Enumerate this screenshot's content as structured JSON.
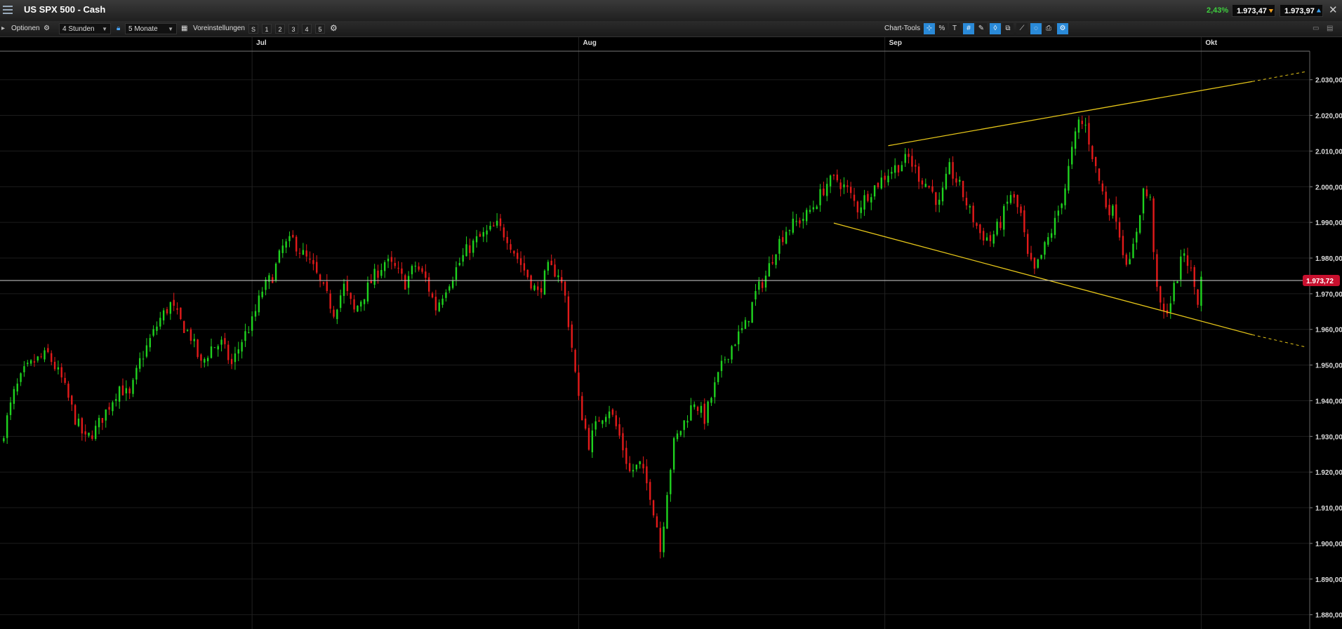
{
  "window": {
    "title": "US SPX 500 - Cash",
    "change_pct": "2,43%",
    "bid": "1.973,47",
    "ask": "1.973,97"
  },
  "toolbar": {
    "options_label": "Optionen",
    "interval_value": "4 Stunden",
    "range_value": "5 Monate",
    "presets_label": "Voreinstellungen",
    "preset_buttons": [
      "S",
      "1",
      "2",
      "3",
      "4",
      "5"
    ],
    "chart_tools_label": "Chart-Tools",
    "tool_icons": [
      "crosshair-tool-icon",
      "percent-icon",
      "text-tool-icon",
      "grid-icon",
      "drawing-tool-icon",
      "indicator-icon",
      "compare-icon",
      "trend-tool-icon",
      "lasso-icon",
      "print-icon",
      "settings-tool-icon"
    ]
  },
  "colors": {
    "up": "#1fd21f",
    "down": "#e21a1a",
    "trendline": "#e6c619",
    "grid": "#1c1c1c",
    "price_badge": "#c8102e",
    "change_positive": "#3ecf3e"
  },
  "chart_data": {
    "type": "candlestick",
    "instrument": "US SPX 500 - Cash",
    "interval": "4 Stunden",
    "range": "5 Monate",
    "current_price": 1973.72,
    "current_price_label": "1.973,72",
    "ylim": [
      1876,
      2038
    ],
    "y_ticks": [
      "2.030,00",
      "2.020,00",
      "2.010,00",
      "2.000,00",
      "1.990,00",
      "1.980,00",
      "1.970,00",
      "1.960,00",
      "1.950,00",
      "1.940,00",
      "1.930,00",
      "1.920,00",
      "1.910,00",
      "1.900,00",
      "1.890,00",
      "1.880,00"
    ],
    "y_tick_values": [
      2030,
      2020,
      2010,
      2000,
      1990,
      1980,
      1970,
      1960,
      1950,
      1940,
      1930,
      1920,
      1910,
      1900,
      1890,
      1880
    ],
    "month_labels": [
      "Jul",
      "Aug",
      "Sep",
      "Okt"
    ],
    "bars_total": 360,
    "month_bar_index": [
      74,
      170,
      260,
      353
    ],
    "anchors": [
      [
        0,
        1928
      ],
      [
        4,
        1942
      ],
      [
        7,
        1948
      ],
      [
        10,
        1951
      ],
      [
        14,
        1953
      ],
      [
        18,
        1946
      ],
      [
        22,
        1935
      ],
      [
        25,
        1929
      ],
      [
        28,
        1932
      ],
      [
        31,
        1937
      ],
      [
        35,
        1944
      ],
      [
        38,
        1941
      ],
      [
        41,
        1951
      ],
      [
        44,
        1957
      ],
      [
        47,
        1963
      ],
      [
        50,
        1967
      ],
      [
        53,
        1962
      ],
      [
        56,
        1958
      ],
      [
        59,
        1950
      ],
      [
        62,
        1955
      ],
      [
        65,
        1956
      ],
      [
        68,
        1950
      ],
      [
        71,
        1957
      ],
      [
        74,
        1962
      ],
      [
        77,
        1971
      ],
      [
        80,
        1975
      ],
      [
        83,
        1983
      ],
      [
        86,
        1985
      ],
      [
        89,
        1981
      ],
      [
        92,
        1977
      ],
      [
        95,
        1971
      ],
      [
        98,
        1965
      ],
      [
        101,
        1972
      ],
      [
        104,
        1965
      ],
      [
        107,
        1970
      ],
      [
        110,
        1975
      ],
      [
        113,
        1979
      ],
      [
        116,
        1977
      ],
      [
        119,
        1973
      ],
      [
        122,
        1978
      ],
      [
        125,
        1974
      ],
      [
        128,
        1966
      ],
      [
        131,
        1972
      ],
      [
        134,
        1977
      ],
      [
        137,
        1982
      ],
      [
        140,
        1985
      ],
      [
        143,
        1987
      ],
      [
        146,
        1989
      ],
      [
        149,
        1986
      ],
      [
        152,
        1980
      ],
      [
        155,
        1975
      ],
      [
        158,
        1970
      ],
      [
        161,
        1977
      ],
      [
        164,
        1976
      ],
      [
        166,
        1969
      ],
      [
        168,
        1955
      ],
      [
        170,
        1940
      ],
      [
        173,
        1928
      ],
      [
        176,
        1935
      ],
      [
        179,
        1938
      ],
      [
        182,
        1930
      ],
      [
        185,
        1920
      ],
      [
        188,
        1922
      ],
      [
        191,
        1914
      ],
      [
        193,
        1905
      ],
      [
        194,
        1898
      ],
      [
        196,
        1915
      ],
      [
        198,
        1928
      ],
      [
        201,
        1934
      ],
      [
        204,
        1940
      ],
      [
        207,
        1935
      ],
      [
        210,
        1944
      ],
      [
        213,
        1952
      ],
      [
        216,
        1957
      ],
      [
        219,
        1961
      ],
      [
        222,
        1970
      ],
      [
        225,
        1975
      ],
      [
        228,
        1983
      ],
      [
        231,
        1988
      ],
      [
        234,
        1990
      ],
      [
        237,
        1992
      ],
      [
        240,
        1996
      ],
      [
        243,
        2001
      ],
      [
        246,
        2002
      ],
      [
        249,
        1999
      ],
      [
        252,
        1994
      ],
      [
        255,
        1998
      ],
      [
        258,
        2001
      ],
      [
        261,
        2004
      ],
      [
        264,
        2006
      ],
      [
        267,
        2008
      ],
      [
        270,
        2003
      ],
      [
        273,
        2000
      ],
      [
        276,
        1995
      ],
      [
        279,
        2005
      ],
      [
        282,
        2000
      ],
      [
        285,
        1993
      ],
      [
        288,
        1987
      ],
      [
        291,
        1985
      ],
      [
        294,
        1990
      ],
      [
        297,
        1998
      ],
      [
        300,
        1992
      ],
      [
        302,
        1980
      ],
      [
        304,
        1976
      ],
      [
        307,
        1983
      ],
      [
        310,
        1990
      ],
      [
        313,
        2000
      ],
      [
        315,
        2010
      ],
      [
        317,
        2018
      ],
      [
        319,
        2017
      ],
      [
        322,
        2005
      ],
      [
        325,
        1995
      ],
      [
        328,
        1992
      ],
      [
        330,
        1982
      ],
      [
        332,
        1978
      ],
      [
        334,
        1988
      ],
      [
        336,
        1999
      ],
      [
        338,
        1996
      ],
      [
        340,
        1970
      ],
      [
        342,
        1964
      ],
      [
        344,
        1968
      ],
      [
        346,
        1975
      ],
      [
        348,
        1982
      ],
      [
        350,
        1976
      ],
      [
        352,
        1968
      ],
      [
        353,
        1974
      ]
    ],
    "trendlines": [
      {
        "x": [
          261,
          368
        ],
        "y": [
          2011.5,
          2029.5
        ],
        "extend_dashed_to": [
          384,
          2032.3
        ]
      },
      {
        "x": [
          245,
          368
        ],
        "y": [
          1989.8,
          1958.5
        ],
        "extend_dashed_to": [
          384,
          1955
        ]
      }
    ]
  }
}
